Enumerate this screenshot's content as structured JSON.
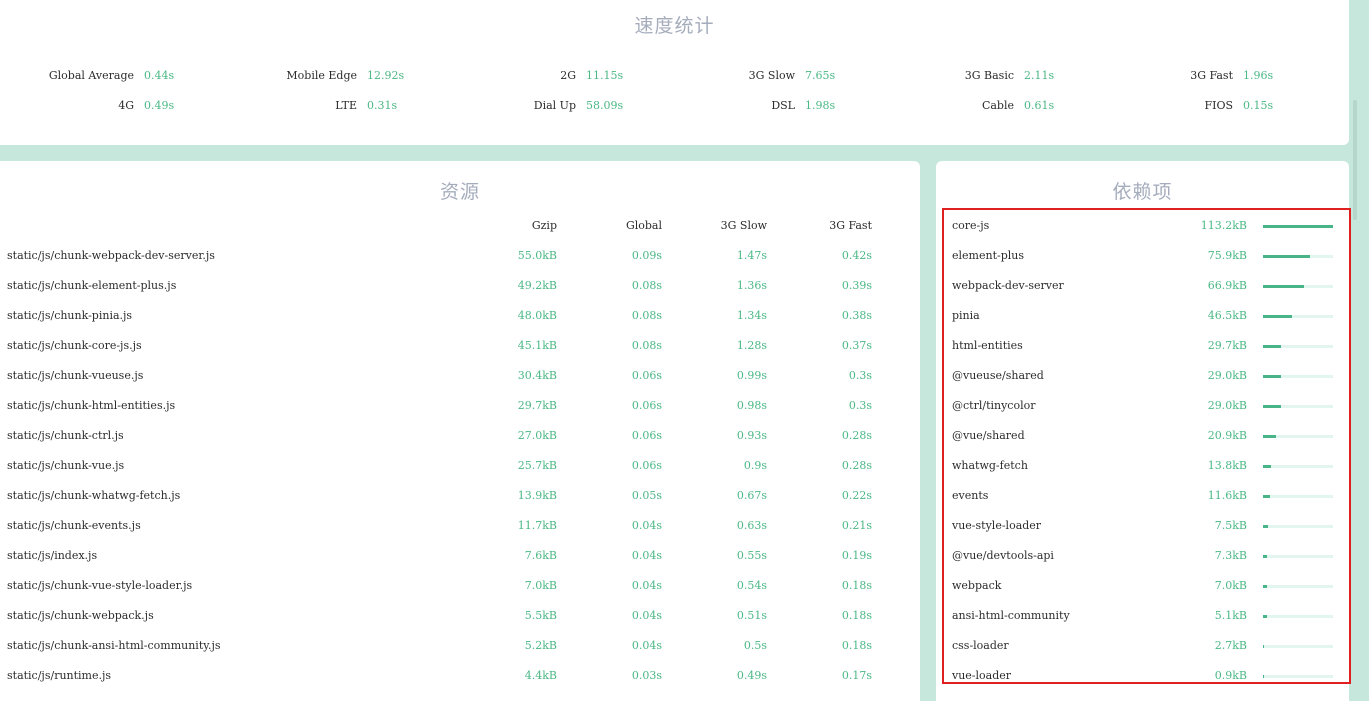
{
  "speed": {
    "title": "速度统计",
    "items": [
      {
        "label": "Global Average",
        "value": "0.44s"
      },
      {
        "label": "Mobile Edge",
        "value": "12.92s"
      },
      {
        "label": "2G",
        "value": "11.15s"
      },
      {
        "label": "3G Slow",
        "value": "7.65s"
      },
      {
        "label": "3G Basic",
        "value": "2.11s"
      },
      {
        "label": "3G Fast",
        "value": "1.96s"
      },
      {
        "label": "4G",
        "value": "0.49s"
      },
      {
        "label": "LTE",
        "value": "0.31s"
      },
      {
        "label": "Dial Up",
        "value": "58.09s"
      },
      {
        "label": "DSL",
        "value": "1.98s"
      },
      {
        "label": "Cable",
        "value": "0.61s"
      },
      {
        "label": "FIOS",
        "value": "0.15s"
      }
    ]
  },
  "assets": {
    "title": "资源",
    "columns": [
      "Gzip",
      "Global",
      "3G Slow",
      "3G Fast"
    ],
    "rows": [
      {
        "name": "static/js/chunk-webpack-dev-server.js",
        "gzip": "55.0kB",
        "global": "0.09s",
        "slow3g": "1.47s",
        "fast3g": "0.42s"
      },
      {
        "name": "static/js/chunk-element-plus.js",
        "gzip": "49.2kB",
        "global": "0.08s",
        "slow3g": "1.36s",
        "fast3g": "0.39s"
      },
      {
        "name": "static/js/chunk-pinia.js",
        "gzip": "48.0kB",
        "global": "0.08s",
        "slow3g": "1.34s",
        "fast3g": "0.38s"
      },
      {
        "name": "static/js/chunk-core-js.js",
        "gzip": "45.1kB",
        "global": "0.08s",
        "slow3g": "1.28s",
        "fast3g": "0.37s"
      },
      {
        "name": "static/js/chunk-vueuse.js",
        "gzip": "30.4kB",
        "global": "0.06s",
        "slow3g": "0.99s",
        "fast3g": "0.3s"
      },
      {
        "name": "static/js/chunk-html-entities.js",
        "gzip": "29.7kB",
        "global": "0.06s",
        "slow3g": "0.98s",
        "fast3g": "0.3s"
      },
      {
        "name": "static/js/chunk-ctrl.js",
        "gzip": "27.0kB",
        "global": "0.06s",
        "slow3g": "0.93s",
        "fast3g": "0.28s"
      },
      {
        "name": "static/js/chunk-vue.js",
        "gzip": "25.7kB",
        "global": "0.06s",
        "slow3g": "0.9s",
        "fast3g": "0.28s"
      },
      {
        "name": "static/js/chunk-whatwg-fetch.js",
        "gzip": "13.9kB",
        "global": "0.05s",
        "slow3g": "0.67s",
        "fast3g": "0.22s"
      },
      {
        "name": "static/js/chunk-events.js",
        "gzip": "11.7kB",
        "global": "0.04s",
        "slow3g": "0.63s",
        "fast3g": "0.21s"
      },
      {
        "name": "static/js/index.js",
        "gzip": "7.6kB",
        "global": "0.04s",
        "slow3g": "0.55s",
        "fast3g": "0.19s"
      },
      {
        "name": "static/js/chunk-vue-style-loader.js",
        "gzip": "7.0kB",
        "global": "0.04s",
        "slow3g": "0.54s",
        "fast3g": "0.18s"
      },
      {
        "name": "static/js/chunk-webpack.js",
        "gzip": "5.5kB",
        "global": "0.04s",
        "slow3g": "0.51s",
        "fast3g": "0.18s"
      },
      {
        "name": "static/js/chunk-ansi-html-community.js",
        "gzip": "5.2kB",
        "global": "0.04s",
        "slow3g": "0.5s",
        "fast3g": "0.18s"
      },
      {
        "name": "static/js/runtime.js",
        "gzip": "4.4kB",
        "global": "0.03s",
        "slow3g": "0.49s",
        "fast3g": "0.17s"
      }
    ]
  },
  "dependencies": {
    "title": "依赖项",
    "items": [
      {
        "name": "core-js",
        "size": "113.2kB",
        "fraction": 1.0
      },
      {
        "name": "element-plus",
        "size": "75.9kB",
        "fraction": 0.67
      },
      {
        "name": "webpack-dev-server",
        "size": "66.9kB",
        "fraction": 0.59
      },
      {
        "name": "pinia",
        "size": "46.5kB",
        "fraction": 0.41
      },
      {
        "name": "html-entities",
        "size": "29.7kB",
        "fraction": 0.26
      },
      {
        "name": "@vueuse/shared",
        "size": "29.0kB",
        "fraction": 0.26
      },
      {
        "name": "@ctrl/tinycolor",
        "size": "29.0kB",
        "fraction": 0.26
      },
      {
        "name": "@vue/shared",
        "size": "20.9kB",
        "fraction": 0.18
      },
      {
        "name": "whatwg-fetch",
        "size": "13.8kB",
        "fraction": 0.12
      },
      {
        "name": "events",
        "size": "11.6kB",
        "fraction": 0.1
      },
      {
        "name": "vue-style-loader",
        "size": "7.5kB",
        "fraction": 0.07
      },
      {
        "name": "@vue/devtools-api",
        "size": "7.3kB",
        "fraction": 0.06
      },
      {
        "name": "webpack",
        "size": "7.0kB",
        "fraction": 0.06
      },
      {
        "name": "ansi-html-community",
        "size": "5.1kB",
        "fraction": 0.05
      },
      {
        "name": "css-loader",
        "size": "2.7kB",
        "fraction": 0.02
      },
      {
        "name": "vue-loader",
        "size": "0.9kB",
        "fraction": 0.01
      }
    ]
  }
}
